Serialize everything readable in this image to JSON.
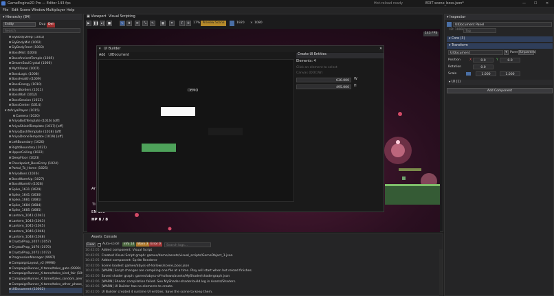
{
  "titlebar": {
    "title": "GameEngine2D Pro — Editor",
    "fps": "143 fps",
    "status": "Hot-reload ready",
    "branch": "EDIT",
    "scene": "scene_boss.json*"
  },
  "menu": [
    "File",
    "Edit",
    "Scene",
    "Window",
    "Multiplayer",
    "Help"
  ],
  "hierarchy": {
    "title": "Hierarchy (84)",
    "mode_label": "Entity",
    "dup_label": "Dup",
    "del_label": "Del",
    "search_placeholder": "Search",
    "items": [
      "SlyBodyDeep (1001)",
      "SlyBodyMid (1002)",
      "SlyBodyFront (1003)",
      "BossMist (1004)",
      "BossAncientTemple (1005)",
      "DreamSoulCrystal (1006)",
      "MythPanel (1007)",
      "BossLogic (1008)",
      "BossHealth (1009)",
      "BossEnergy (1010)",
      "BossBorders (1011)",
      "BossWall (1012)",
      "BossSession (1013)",
      "BossCenter (1014)",
      "AriyaPlayer (1015)",
      "Camera (1020)",
      "AriyaBoltTemplate (1016) [off]",
      "AriyaShieldTemplate (1017) [off]",
      "AriyaDashTemplate (1018) [off]",
      "AriyaDroneTemplate (1019) [off]",
      "LeftBoundary (1020)",
      "RightBoundary (1021)",
      "UpperCeiling (1022)",
      "DeepFloor (1023)",
      "Checkpoint_BossEntry (1024)",
      "Portal_To_Home (1025)",
      "AriyaBoss (1026)",
      "BossWarmUp (1027)",
      "BossWarmth (1028)",
      "Spike_1631 (1629)",
      "Spike_1641 (1630)",
      "Spike_1681 (1681)",
      "Spike_1684 (1684)",
      "Spike_1685 (1685)",
      "Lantern_1041 (1041)",
      "Lantern_1043 (1043)",
      "Lantern_1045 (1045)",
      "Lantern_1046 (1046)",
      "Lantern_1048 (1048)",
      "CrystalProp_1057 (1057)",
      "CrystalProp_1070 (1070)",
      "CrystalProp_1072 (1072)",
      "ProgressionManager (9997)",
      "CampaignLayout_v2 (9998)",
      "CampaignRunner_X.tome/tales_gate (9999)",
      "CampaignRunner_X.tome/tales_kind_fair (10000)",
      "CampaignRunner_X.tome/tales_random_arena (10001)",
      "CampaignRunner_X.tome/tales_other_phase_chomb",
      "UIDocument (10002)"
    ]
  },
  "tabs": {
    "viewport": "Viewport",
    "visual": "Visual Scripting"
  },
  "toolbar": {
    "zoom": "17%",
    "preset": "Preview Scene",
    "width": "1920",
    "times": "×",
    "height": "1080",
    "fps_badge": "143 FPS"
  },
  "ui_builder": {
    "title": "UI Builder",
    "add": "Add",
    "doc": "UIDocument",
    "demo": "DEMO",
    "create_btn": "Create UI Entities",
    "elements": "Elements: 4",
    "hint1": "Click an element to select",
    "hint2": "Canvas (DOC/W)",
    "w_value": "630.000",
    "w_label": "W",
    "h_value": "495.000",
    "h_label": "H",
    "close": "✕"
  },
  "game": {
    "hp": "HP 8 / 8",
    "en": "EN 100",
    "score": "Ti",
    "left": "Ar"
  },
  "inspector": {
    "title": "Inspector",
    "entity_name": "UIDocument Panel",
    "id_label": "ID: 10004",
    "tag_placeholder": "Tag",
    "core": "Core (3)",
    "transform": "Transform",
    "parent_field": "UIDocument",
    "parent_label": "Parent",
    "parent_value": "[Unparent]",
    "pos_label": "Position",
    "pos_x": "0.0",
    "pos_y": "0.0",
    "rot_label": "Rotation",
    "rot_val": "0.0",
    "scale_label": "Scale",
    "scale_x": "1.000",
    "scale_y": "1.000",
    "ui": "UI (1)",
    "add_component": "Add Component",
    "x": "X",
    "y": "Y"
  },
  "console": {
    "tab_assets": "Assets",
    "tab_console": "Console",
    "clear": "Clear",
    "autoscroll": "Auto-scroll",
    "info": "Info 14",
    "warn": "Warn 3",
    "error": "Error 0",
    "search_placeholder": "Search logs...",
    "lines": [
      {
        "t": "10:42:05",
        "m": "Added component: Visual Script",
        "w": false
      },
      {
        "t": "10:42:05",
        "m": "Created Visual Script graph: games/demo/assets/visual_scripts/GameObject_1.json",
        "w": false
      },
      {
        "t": "10:42:05",
        "m": "Added component: Sprite Renderer",
        "w": false
      },
      {
        "t": "10:42:06",
        "m": "Scene loaded: games/abyss-of-hollows/scene_boss.json",
        "w": false
      },
      {
        "t": "10:42:06",
        "m": "[WARN] Script changes are compiling one file at a time. Play will start when hot reload finishes.",
        "w": true
      },
      {
        "t": "10:42:06",
        "m": "Saved shader graph: games/abyss-of-hollows/assets/MyShader/shadergraph.json",
        "w": false
      },
      {
        "t": "10:42:06",
        "m": "[WARN] Shader compilation failed. See MyShader-shader-build.log in Assets/Shaders.",
        "w": true
      },
      {
        "t": "10:42:06",
        "m": "[WARN] UI Builder has no elements to create.",
        "w": true
      },
      {
        "t": "10:42:06",
        "m": "UI Builder created 4 runtime UI entities. Save the scene to keep them.",
        "w": false
      }
    ]
  }
}
